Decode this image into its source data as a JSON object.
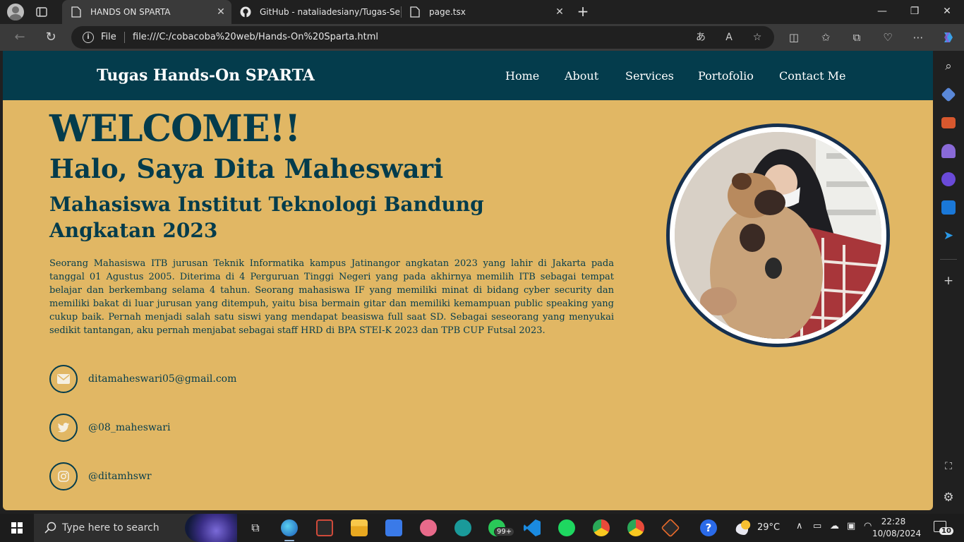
{
  "browser": {
    "tabs": [
      {
        "title": "HANDS ON SPARTA",
        "active": true
      },
      {
        "title": "GitHub - nataliadesiany/Tugas-Se",
        "active": false
      },
      {
        "title": "page.tsx",
        "active": false
      }
    ],
    "address": {
      "scheme_label": "File",
      "url": "file:///C:/cobacoba%20web/Hands-On%20Sparta.html"
    }
  },
  "site": {
    "brand": "Tugas Hands-On SPARTA",
    "nav": [
      "Home",
      "About",
      "Services",
      "Portofolio",
      "Contact Me"
    ],
    "hero": {
      "welcome": "WELCOME!!",
      "name": "Halo, Saya Dita Maheswari",
      "subtitle": "Mahasiswa Institut Teknologi Bandung Angkatan 2023",
      "description": "Seorang Mahasiswa ITB jurusan Teknik Informatika kampus Jatinangor angkatan 2023 yang lahir di Jakarta pada tanggal 01 Agustus 2005. Diterima di 4 Perguruan Tinggi Negeri yang pada akhirnya memilih ITB sebagai tempat belajar dan berkembang selama 4 tahun. Seorang mahasiswa IF yang memiliki minat di bidang cyber security dan memiliki bakat di luar jurusan yang ditempuh, yaitu bisa bermain gitar dan memiliki kemampuan public speaking yang cukup baik. Pernah menjadi salah satu siswi yang mendapat beasiswa full saat SD. Sebagai seseorang yang menyukai sedikit tantangan, aku pernah menjabat sebagai staff HRD di BPA STEI-K 2023 dan TPB CUP Futsal 2023."
    },
    "contacts": [
      {
        "icon": "mail-icon",
        "text": "ditamaheswari05@gmail.com"
      },
      {
        "icon": "twitter-icon",
        "text": "@08_maheswari"
      },
      {
        "icon": "instagram-icon",
        "text": "@ditamhswr"
      }
    ],
    "colors": {
      "navbar": "#043c4c",
      "page_background": "#e1b764",
      "text": "#043c4c",
      "photo_ring": "#16304f"
    }
  },
  "taskbar": {
    "search_placeholder": "Type here to search",
    "whatsapp_badge": "99+",
    "weather": "29°C",
    "time": "22:28",
    "date": "10/08/2024",
    "notification_count": "10"
  }
}
